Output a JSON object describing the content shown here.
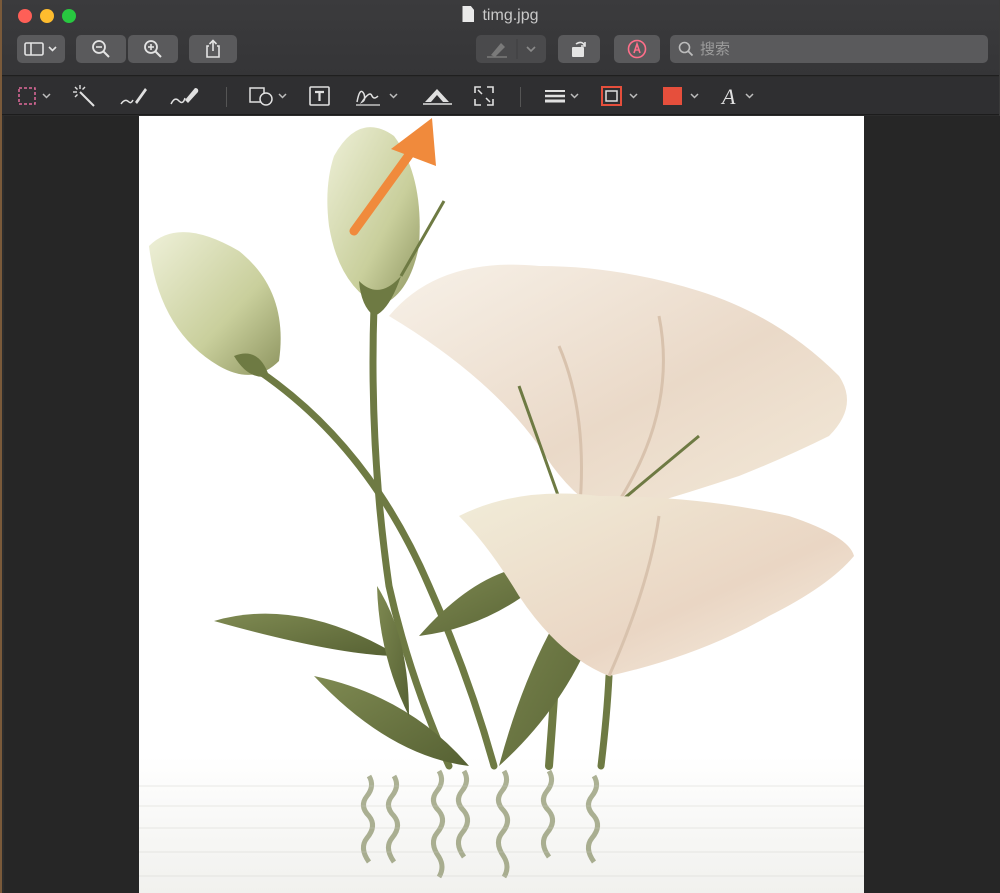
{
  "window": {
    "title": "timg.jpg"
  },
  "toolbar": {
    "search_placeholder": "搜索"
  },
  "colors": {
    "accent_arrow": "#f08a3c",
    "markup_stroke": "#e64f3c",
    "markup_fill": "#e64f3c",
    "selection_border": "#e06a9a"
  }
}
